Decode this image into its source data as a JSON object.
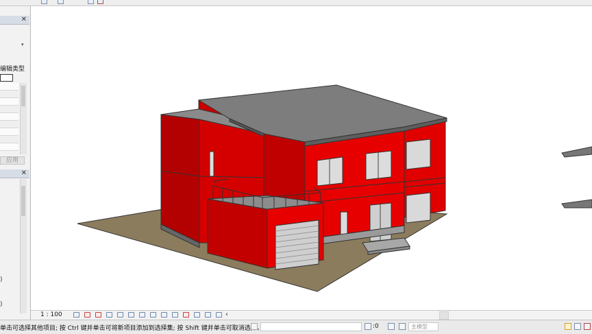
{
  "left_panel": {
    "properties": {
      "close_symbol": "✕",
      "dropdown_arrow": "▾",
      "edit_type_label": "编辑类型",
      "apply_label": "应用"
    },
    "browser": {
      "close_symbol": "✕",
      "row_glyphs": [
        ")",
        ")"
      ]
    }
  },
  "view_control_bar": {
    "scale": "1 : 100",
    "more_arrow": "‹"
  },
  "status_bar": {
    "hint": "单击可选择其他项目; 按 Ctrl 键并单击可将新项目添加到选择集; 按 Shift 键并单击可取消选择。",
    "selection_count": ":0",
    "model_placeholder": "主模型"
  },
  "colors": {
    "wall_red": "#e60000",
    "wall_shade": "#b00000",
    "roof": "#7c7c7c",
    "ground": "#8a7b5c",
    "accent": "#2b579a"
  },
  "icons": [
    "close-icon",
    "dropdown-arrow-icon",
    "view-control-icons",
    "filter-icon",
    "settings-icon"
  ]
}
